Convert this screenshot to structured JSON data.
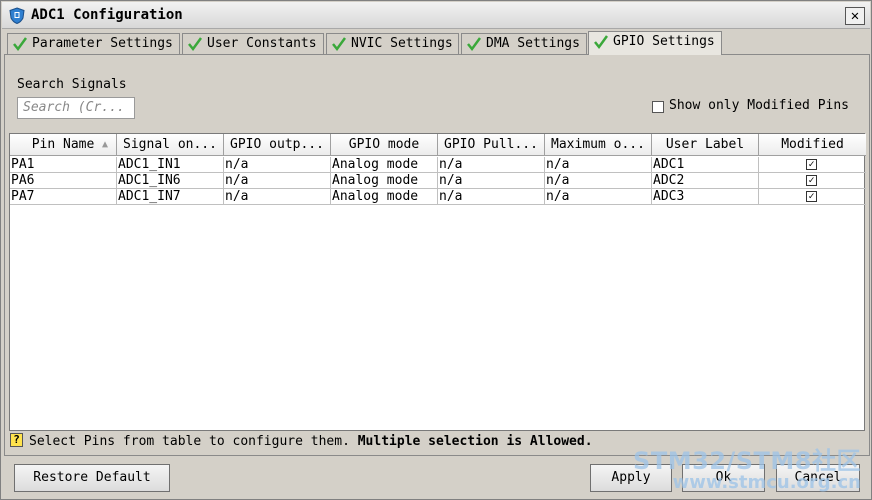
{
  "window": {
    "title": "ADC1 Configuration",
    "close_label": "✕"
  },
  "tabs": [
    {
      "label": "Parameter Settings",
      "active": false
    },
    {
      "label": "User Constants",
      "active": false
    },
    {
      "label": "NVIC Settings",
      "active": false
    },
    {
      "label": "DMA Settings",
      "active": false
    },
    {
      "label": "GPIO Settings",
      "active": true
    }
  ],
  "search": {
    "label": "Search Signals",
    "placeholder": "Search (Cr..."
  },
  "filter": {
    "show_modified_label": "Show only Modified Pins",
    "checked": false
  },
  "table": {
    "columns": [
      "Pin Name",
      "Signal on...",
      "GPIO outp...",
      "GPIO mode",
      "GPIO Pull...",
      "Maximum o...",
      "User Label",
      "Modified"
    ],
    "sort_indicator": "▲",
    "rows": [
      {
        "pin": "PA1",
        "signal": "ADC1_IN1",
        "output": "n/a",
        "mode": "Analog mode",
        "pull": "n/a",
        "max": "n/a",
        "label": "ADC1",
        "modified": true
      },
      {
        "pin": "PA6",
        "signal": "ADC1_IN6",
        "output": "n/a",
        "mode": "Analog mode",
        "pull": "n/a",
        "max": "n/a",
        "label": "ADC2",
        "modified": true
      },
      {
        "pin": "PA7",
        "signal": "ADC1_IN7",
        "output": "n/a",
        "mode": "Analog mode",
        "pull": "n/a",
        "max": "n/a",
        "label": "ADC3",
        "modified": true
      }
    ],
    "check_glyph": "✓"
  },
  "hint": {
    "icon": "?",
    "text": "Select Pins from table to configure them.",
    "strong": "Multiple selection is Allowed."
  },
  "buttons": {
    "restore": "Restore Default",
    "apply": "Apply",
    "ok": "Ok",
    "cancel": "Cancel"
  },
  "watermark": {
    "line1": "STM32/STM8社区",
    "line2": "www.stmcu.org.cn"
  },
  "colors": {
    "title_icon": "#2f7fd0",
    "check_green": "#3aa83a"
  }
}
